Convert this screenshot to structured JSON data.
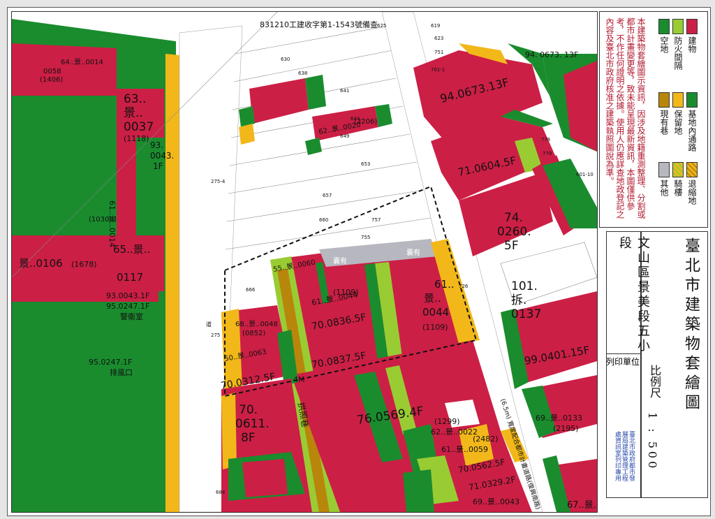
{
  "header": {
    "permit_text": "831210工建收字第1-1543號備查"
  },
  "map": {
    "colors": {
      "building": "#cc1f45",
      "open_space": "#1a8c2e",
      "fire_lane": "#99cc33",
      "arcade": "#f2b81a",
      "existing_lane": "#b8860b",
      "other": "#b7b7c0",
      "road": "#ffffff"
    },
    "labels": {
      "lot_94_0673": "94.0673.13F",
      "lot_94_0673_short": "94. 0673. 13F",
      "lot_71_0604": "71.0604.5F",
      "lot_74_0260_a": "74.",
      "lot_74_0260_b": "0260.",
      "lot_74_0260_c": "5F",
      "lot_101_a": "101.",
      "lot_101_b": "拆.",
      "lot_101_c": "0137",
      "lot_99_0401": "99.0401.15F",
      "lot_69_0133": "69..景..0133",
      "lot_69_0133_area": "(2195)",
      "lot_76_0569": "76.0569.4F",
      "lot_70_0837": "70.0837.5F",
      "lot_70_0836": "70.0836.5F",
      "lot_70_0312": "70.0312.5F",
      "lot_70_0611_a": "70.",
      "lot_70_0611_b": "0611.",
      "lot_70_0611_c": "8F",
      "lot_61_0044": "61..景..0044",
      "lot_61_0044_area": "(1109)",
      "lot_61_right_a": "61..",
      "lot_61_right_b": "景..",
      "lot_61_right_c": "0044",
      "lot_61_right_area": "(1109)",
      "lot_63_a": "63..",
      "lot_63_b": "景..",
      "lot_63_c": "0037",
      "lot_63_area": "(1118)",
      "lot_93_a": "93.",
      "lot_93_b": "0043.",
      "lot_93_c": "1F",
      "lot_64_0014": "64..景..0014",
      "lot_64_0058": "0058",
      "lot_64_1406": "(1406)",
      "lot_61_1030": "61..景..0014",
      "lot_1030": "(1030)",
      "lot_65": "65..景..",
      "lot_0117": "0117",
      "lot_0106": "景..0106",
      "lot_1678": "(1678)",
      "lot_93_0043": "93.0043.1F",
      "lot_95_0247": "95.0247.1F",
      "lot_95_0247b": "95.0247.1F",
      "guard_room": "警衛室",
      "entrance": "排風口",
      "lot_62_0020": "62..景..0020",
      "lot_62_3206": "(3206)",
      "lot_55_0060": "55..景..0060",
      "lot_68_0048": "68..景..0048",
      "lot_0852": "(0852)",
      "lot_50_0063": "50..景..0063",
      "lot_62_0022": "62..景..0022",
      "lot_1299": "(1299)",
      "lot_61_0059": "61..景..0059",
      "lot_2482": "(2482)",
      "lot_70_0562": "70.0562.5F",
      "lot_71_0329": "71.0329.2F",
      "lot_69_0043": "69..景..0043",
      "lot_67": "67..景..",
      "lane_4m": "4M",
      "lane_name": "拱照巷",
      "gap_a": "囊有",
      "gap_b": "囊有",
      "road_west": "道",
      "road_east_text": "(6.5m)  寬度配合都市計畫道路(復興南路)",
      "parcel_274": "275-4",
      "parcel_275": "275",
      "parcel_755": "755",
      "parcel_757": "757",
      "parcel_751": "751",
      "parcel_776": "776",
      "parcel_779": "779",
      "parcel_601": "601-10",
      "parcel_619": "619",
      "parcel_623": "623",
      "parcel_625": "625",
      "parcel_630": "630",
      "parcel_638": "638",
      "parcel_641": "641",
      "parcel_644": "644",
      "parcel_649": "649",
      "parcel_653": "653",
      "parcel_657": "657",
      "parcel_660": "660",
      "parcel_666": "666",
      "parcel_684": "684",
      "parcel_761": "761-1",
      "parcel_726": "726"
    }
  },
  "legend": {
    "items": [
      {
        "label": "建物",
        "color": "#cc1f45"
      },
      {
        "label": "防火間隔",
        "color": "#99cc33"
      },
      {
        "label": "空地",
        "color": "#1a8c2e"
      },
      {
        "label": "基地內通路",
        "color": "#1a8c2e"
      },
      {
        "label": "保留地",
        "color": "#f2b81a"
      },
      {
        "label": "現有巷",
        "color": "#b8860b"
      },
      {
        "label": "退縮地",
        "color": "#f2b81a"
      },
      {
        "label": "騎樓",
        "color": "#f2b81a"
      },
      {
        "label": "其他",
        "color": "#b7b7c0"
      }
    ],
    "note": "本建築物套繪圖示資訊，因涉及地籍重測整理、分割或都市計畫變更等，致未能呈現最新資訊，本圖僅供參考，不作任何證明之依據。使用人仍應詳查地政登記之內容及臺北市政府核准之建築執照圖說為準。"
  },
  "title": {
    "main": "臺北市建築物套繪圖",
    "district": "文山區景美段五小段",
    "scale_label": "比例尺",
    "scale_value": "1 : 500",
    "print_unit_label": "列印單位",
    "stamp": "臺北市政府都市發展局建築管理工程處資訊室列印專用"
  }
}
